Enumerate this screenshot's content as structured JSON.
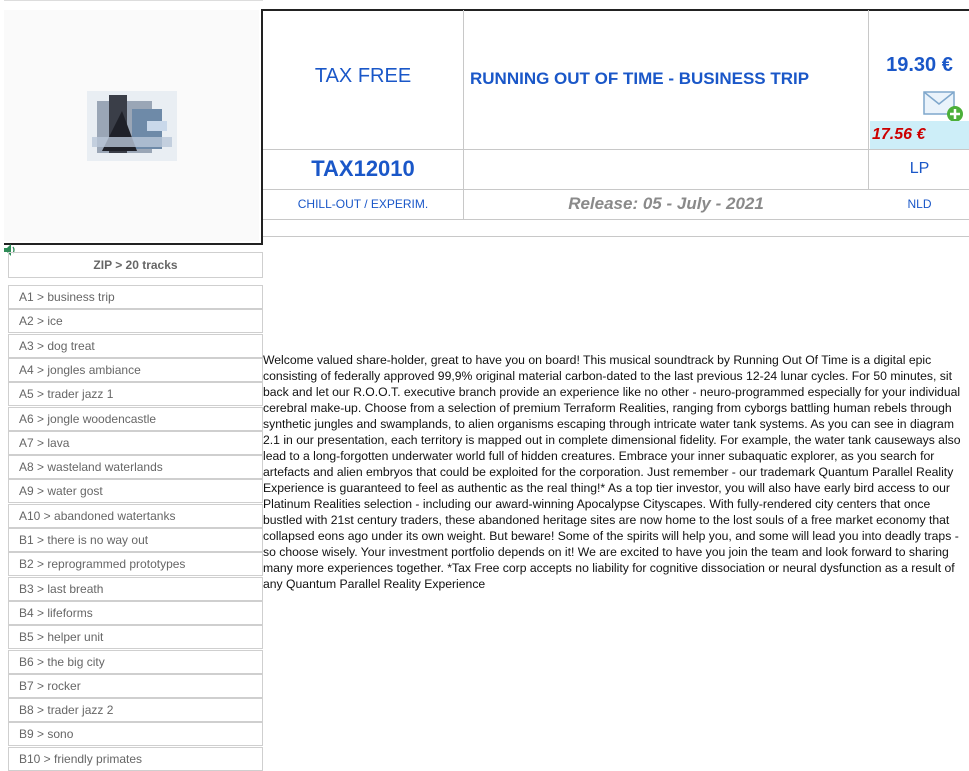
{
  "product": {
    "label": "TAX FREE",
    "title": "RUNNING OUT OF TIME - BUSINESS TRIP",
    "price": "19.30 €",
    "sale_price": "17.56 €",
    "catalog": "TAX12010",
    "format": "LP",
    "genre": "CHILL-OUT / EXPERIM.",
    "release": "Release: 05 - July - 2021",
    "country": "NLD"
  },
  "tracklist": {
    "header": "ZIP > 20 tracks",
    "tracks": [
      "A1 > business trip",
      "A2 > ice",
      "A3 > dog treat",
      "A4 > jongles ambiance",
      "A5 > trader jazz 1",
      "A6 > jongle woodencastle",
      "A7 > lava",
      "A8 > wasteland waterlands",
      "A9 > water gost",
      "A10 > abandoned watertanks",
      "B1 > there is no way out",
      "B2 > reprogrammed prototypes",
      "B3 > last breath",
      "B4 > lifeforms",
      "B5 > helper unit",
      "B6 > the big city",
      "B7 > rocker",
      "B8 > trader jazz 2",
      "B9 > sono",
      "B10 > friendly primates"
    ]
  },
  "description": "Welcome valued share-holder, great to have you on board! This musical soundtrack by Running Out Of Time is a digital epic consisting of federally approved 99,9% original material carbon-dated to the last previous 12-24 lunar cycles. For 50 minutes, sit back and let our R.O.O.T. executive branch provide an experience like no other - neuro-programmed especially for your individual cerebral make-up. Choose from a selection of premium Terraform Realities, ranging from cyborgs battling human rebels through synthetic jungles and swamplands, to alien organisms escaping through intricate water tank systems. As you can see in diagram 2.1 in our presentation, each territory is mapped out in complete dimensional fidelity. For example, the water tank causeways also lead to a long-forgotten underwater world full of hidden creatures. Embrace your inner subaquatic explorer, as you search for artefacts and alien embryos that could be exploited for the corporation. Just remember - our trademark Quantum Parallel Reality Experience is guaranteed to feel as authentic as the real thing!* As a top tier investor, you will also have early bird access to our Platinum Realities selection - including our award-winning Apocalypse Cityscapes. With fully-rendered city centers that once bustled with 21st century traders, these abandoned heritage sites are now home to the lost souls of a free market economy that collapsed eons ago under its own weight. But beware! Some of the spirits will help you, and some will lead you into deadly traps - so choose wisely. Your investment portfolio depends on it! We are excited to have you join the team and look forward to sharing many more experiences together. *Tax Free corp accepts no liability for cognitive dissociation or neural dysfunction as a result of any Quantum Parallel Reality Experience",
  "icons": {
    "cart": "envelope-add-icon",
    "audio": "speaker-icon"
  },
  "colors": {
    "label_blue": "#1a57c8",
    "price_blue": "#1a57c8",
    "sale_red": "#cc0000",
    "sale_bg": "#cdeef8"
  }
}
